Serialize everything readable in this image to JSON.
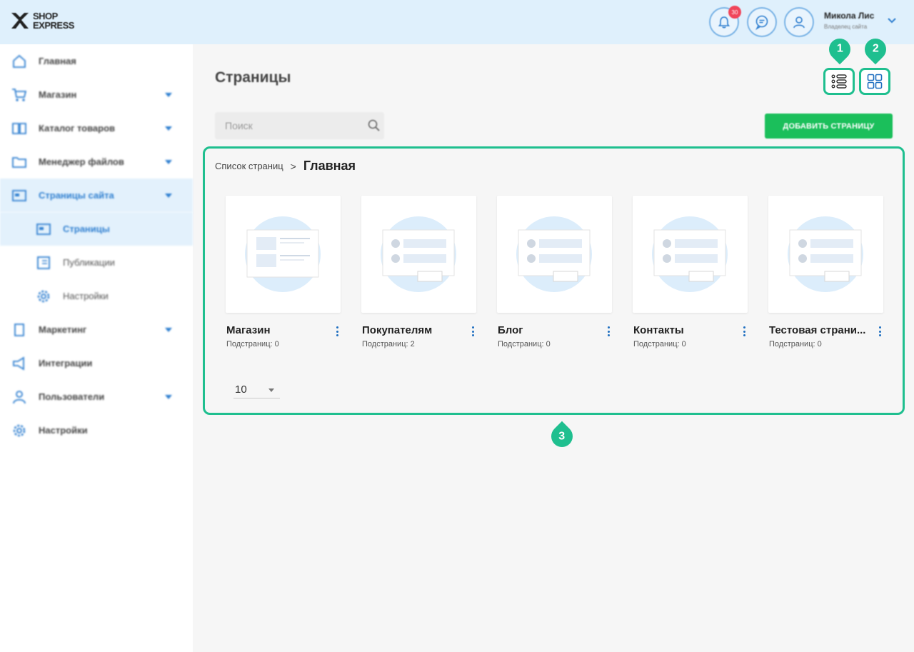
{
  "header": {
    "logo_line1": "SHOP",
    "logo_line2": "EXPRESS",
    "notifications_count": "30",
    "user_name": "Микола Лис",
    "user_role": "Владелец сайта"
  },
  "sidebar": {
    "items": [
      {
        "label": "Главная",
        "icon": "home-icon"
      },
      {
        "label": "Магазин",
        "icon": "cart-icon"
      },
      {
        "label": "Каталог товаров",
        "icon": "catalog-icon"
      },
      {
        "label": "Менеджер файлов",
        "icon": "folder-icon"
      },
      {
        "label": "Страницы сайта",
        "icon": "pages-icon"
      },
      {
        "label": "Страницы",
        "icon": "page-icon"
      },
      {
        "label": "Публикации",
        "icon": "publications-icon"
      },
      {
        "label": "Настройки",
        "icon": "gear-icon"
      },
      {
        "label": "Маркетинг",
        "icon": "marketing-icon"
      },
      {
        "label": "Интеграции",
        "icon": "megaphone-icon"
      },
      {
        "label": "Пользователи",
        "icon": "users-icon"
      },
      {
        "label": "Настройки",
        "icon": "gear-icon"
      }
    ]
  },
  "main": {
    "title": "Страницы",
    "search_placeholder": "Поиск",
    "add_button": "ДОБАВИТЬ СТРАНИЦУ",
    "breadcrumb_root": "Список страниц",
    "breadcrumb_sep": ">",
    "breadcrumb_current": "Главная",
    "cards": [
      {
        "name": "Магазин",
        "sub": "Подстраниц: 0",
        "style": "document"
      },
      {
        "name": "Покупателям",
        "sub": "Подстраниц: 2",
        "style": "list"
      },
      {
        "name": "Блог",
        "sub": "Подстраниц: 0",
        "style": "list"
      },
      {
        "name": "Контакты",
        "sub": "Подстраниц: 0",
        "style": "list"
      },
      {
        "name": "Тестовая страни...",
        "sub": "Подстраниц: 0",
        "style": "list"
      }
    ],
    "page_size": "10"
  },
  "markers": [
    "1",
    "2",
    "3"
  ],
  "colors": {
    "accent_teal": "#1fbf8f",
    "primary_blue": "#2f7fd0",
    "add_green": "#1bbf5b",
    "header_bg": "#dff0fc"
  }
}
